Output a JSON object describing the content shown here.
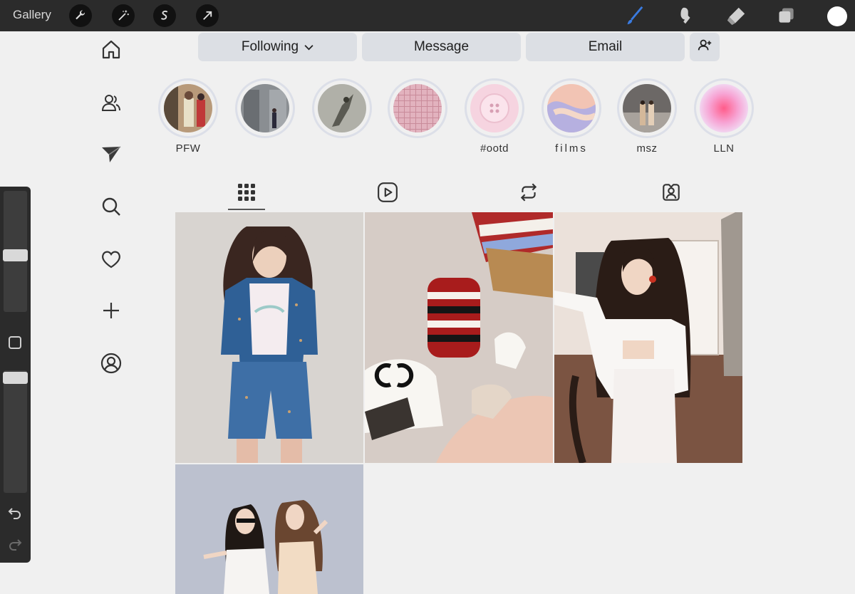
{
  "app": {
    "gallery_label": "Gallery"
  },
  "colors": {
    "topbar": "#2b2b2b",
    "brush_accent": "#3a7be0",
    "button_bg": "#dcdfe4",
    "canvas_bg": "#f0f0f0"
  },
  "top_tools_left": [
    "wrench-icon",
    "magic-wand-icon",
    "selection-icon",
    "transform-arrow-icon"
  ],
  "top_tools_right": [
    "brush-icon",
    "smudge-icon",
    "eraser-icon",
    "layers-icon",
    "color-icon"
  ],
  "side_nav": [
    "home-icon",
    "people-icon",
    "paper-plane-icon",
    "search-icon",
    "heart-icon",
    "plus-icon",
    "profile-icon"
  ],
  "actions": {
    "following": "Following",
    "message": "Message",
    "email": "Email"
  },
  "highlights": [
    {
      "label": "PFW"
    },
    {
      "label": ""
    },
    {
      "label": ""
    },
    {
      "label": ""
    },
    {
      "label": "#ootd"
    },
    {
      "label": "films"
    },
    {
      "label": "msz"
    },
    {
      "label": "LLN"
    }
  ],
  "tabs": [
    "grid-icon",
    "reels-icon",
    "reposts-icon",
    "tagged-icon"
  ]
}
